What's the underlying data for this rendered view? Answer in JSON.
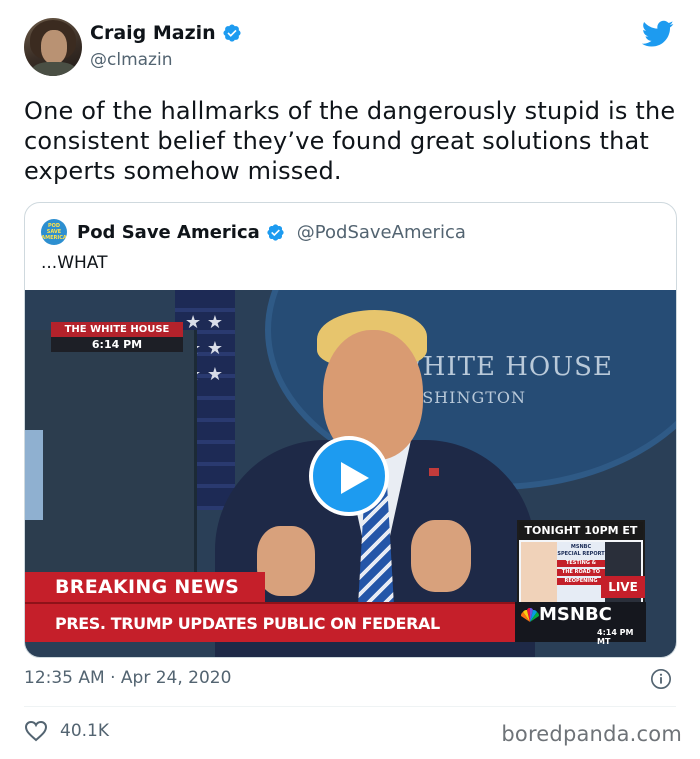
{
  "author": {
    "name": "Craig Mazin",
    "handle": "@clmazin"
  },
  "tweet": {
    "text": "One of the hallmarks of the dangerously stupid is the consistent belief they’ve found great solutions that experts somehow missed.",
    "timestamp": "12:35 AM · Apr 24, 2020",
    "likes": "40.1K"
  },
  "quoted": {
    "name": "Pod Save America",
    "handle": "@PodSaveAmerica",
    "text": "...WHAT",
    "avatar_text": "POD SAVE AMERICA"
  },
  "video": {
    "location_label": "THE WHITE HOUSE",
    "location_time": "6:14 PM",
    "seal_line1": "WHITE HOUSE",
    "seal_line2": "WASHINGTON",
    "promo_title": "TONIGHT 10PM ET",
    "promo_line1": "MSNBC",
    "promo_line2": "SPECIAL REPORT",
    "promo_line3": "TESTING &",
    "promo_line4": "THE ROAD TO",
    "promo_line5": "REOPENING",
    "live_label": "LIVE",
    "breaking_label": "BREAKING NEWS",
    "chyron": "PRES. TRUMP UPDATES PUBLIC ON FEDERAL RESPONSE TO VIRUS",
    "network": "MSNBC",
    "network_time": "4:14 PM MT"
  },
  "watermark": "boredpanda.com",
  "colors": {
    "twitter_blue": "#1d9bf0",
    "text_primary": "#0f1419",
    "text_secondary": "#536471",
    "breaking_red": "#c51f2a"
  },
  "icons": {
    "verified": "verified-badge-icon",
    "logo": "twitter-bird-icon",
    "play": "play-icon",
    "info": "info-icon",
    "like": "heart-icon"
  }
}
